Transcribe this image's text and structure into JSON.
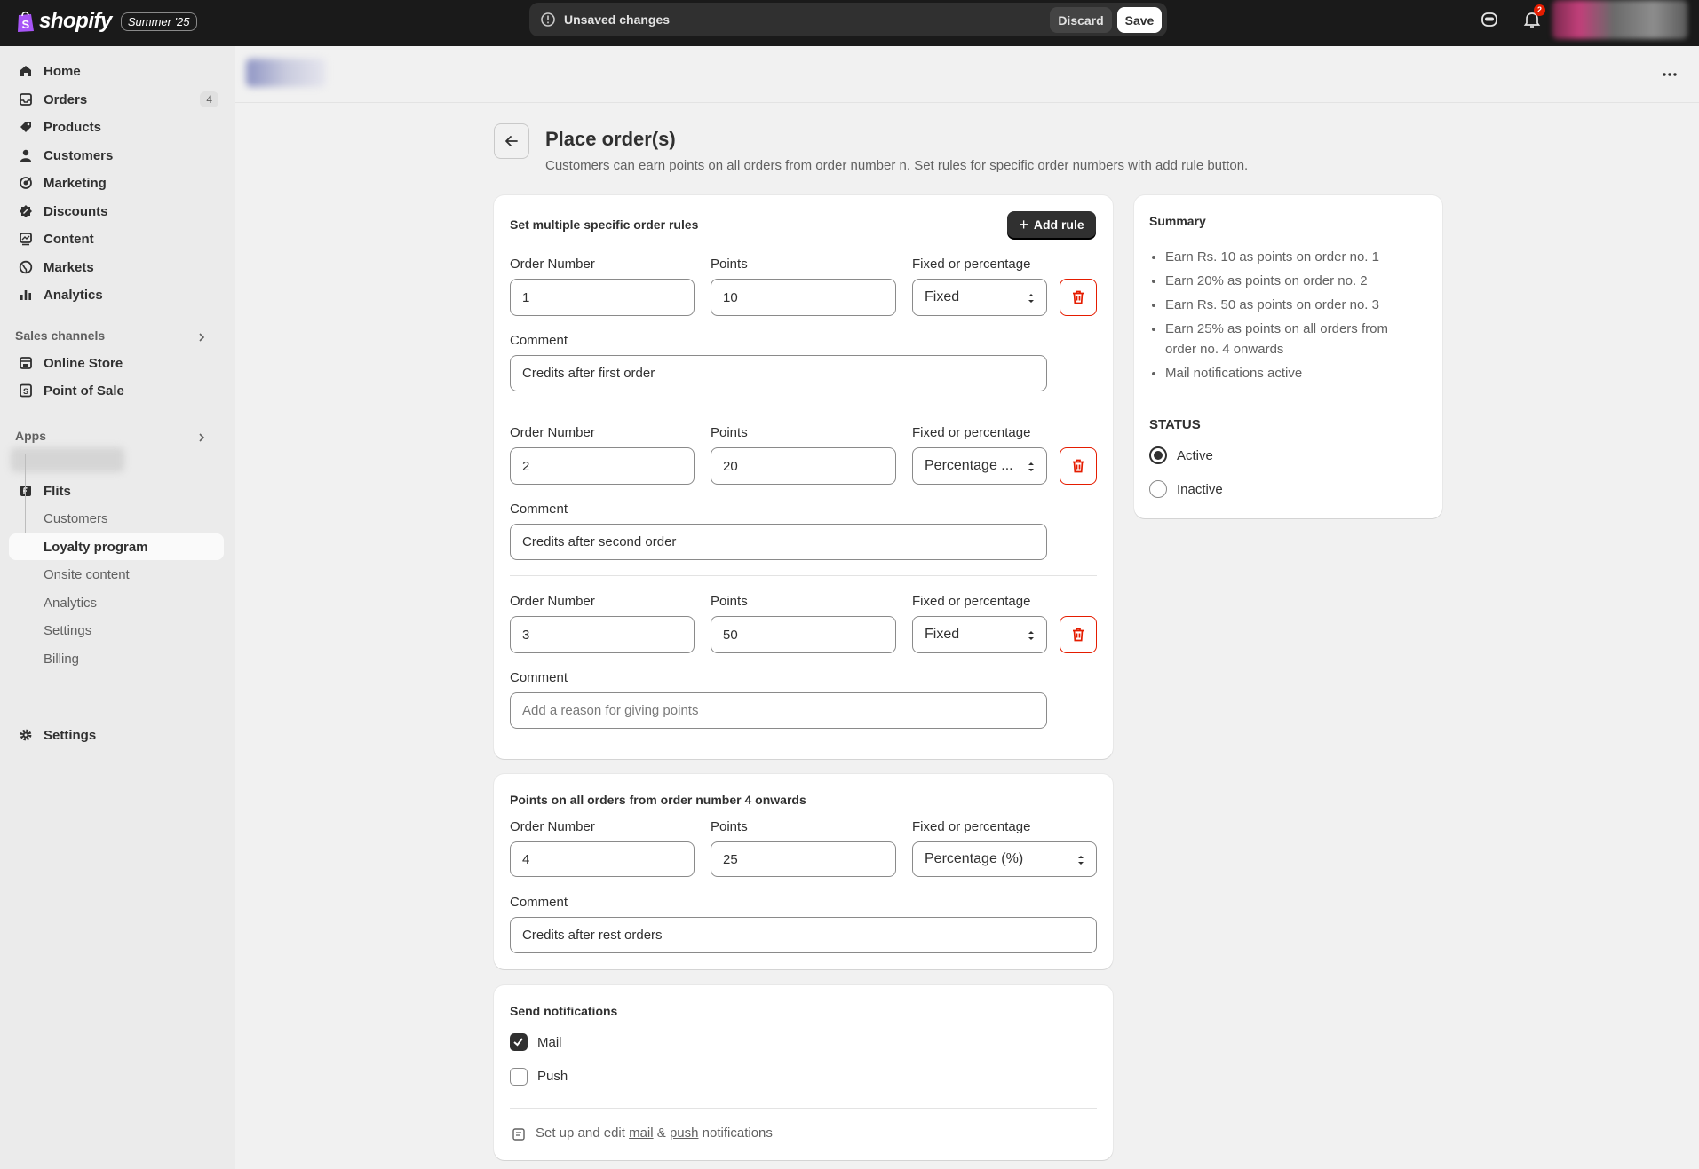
{
  "topbar": {
    "logo_text": "shopify",
    "badge": "Summer '25",
    "unsaved_text": "Unsaved changes",
    "discard_label": "Discard",
    "save_label": "Save",
    "notification_count": "2"
  },
  "sidebar": {
    "items": [
      {
        "label": "Home",
        "icon": "home-icon"
      },
      {
        "label": "Orders",
        "icon": "inbox-icon",
        "count": "4"
      },
      {
        "label": "Products",
        "icon": "tag-icon"
      },
      {
        "label": "Customers",
        "icon": "person-icon"
      },
      {
        "label": "Marketing",
        "icon": "target-icon"
      },
      {
        "label": "Discounts",
        "icon": "discount-icon"
      },
      {
        "label": "Content",
        "icon": "content-icon"
      },
      {
        "label": "Markets",
        "icon": "globe-icon"
      },
      {
        "label": "Analytics",
        "icon": "bar-chart-icon"
      }
    ],
    "sales_channels_title": "Sales channels",
    "channels": [
      {
        "label": "Online Store",
        "icon": "store-icon"
      },
      {
        "label": "Point of Sale",
        "icon": "pos-icon"
      }
    ],
    "apps_title": "Apps",
    "app_name": "Flits",
    "app_sub_items": [
      "Customers",
      "Loyalty program",
      "Onsite content",
      "Analytics",
      "Settings",
      "Billing"
    ],
    "settings_label": "Settings"
  },
  "page": {
    "title": "Place order(s)",
    "subtitle": "Customers can earn points on all orders from order number n. Set rules for specific order numbers with add rule button."
  },
  "rules_card": {
    "title": "Set multiple specific order rules",
    "add_rule_label": "Add rule",
    "order_number_label": "Order Number",
    "points_label": "Points",
    "type_label": "Fixed or percentage",
    "comment_label": "Comment",
    "comment_placeholder": "Add a reason for giving points",
    "rules": [
      {
        "order_number": "1",
        "points": "10",
        "type": "Fixed",
        "comment": "Credits after first order"
      },
      {
        "order_number": "2",
        "points": "20",
        "type": "Percentage ...",
        "comment": "Credits after second order"
      },
      {
        "order_number": "3",
        "points": "50",
        "type": "Fixed",
        "comment": ""
      }
    ]
  },
  "onward_card": {
    "title": "Points on all orders from order number 4 onwards",
    "order_number_label": "Order Number",
    "points_label": "Points",
    "type_label": "Fixed or percentage",
    "comment_label": "Comment",
    "order_number": "4",
    "points": "25",
    "type": "Percentage (%)",
    "comment": "Credits after rest orders"
  },
  "notifications_card": {
    "title": "Send notifications",
    "mail_label": "Mail",
    "mail_checked": true,
    "push_label": "Push",
    "push_checked": false,
    "footer_prefix": "Set up and edit",
    "mail_link": "mail",
    "amp": "&",
    "push_link": "push",
    "footer_suffix": "notifications"
  },
  "summary_card": {
    "title": "Summary",
    "lines": [
      "Earn Rs. 10 as points on order no. 1",
      "Earn 20% as points on order no. 2",
      "Earn Rs. 50 as points on order no. 3",
      "Earn 25% as points on all orders from order no. 4 onwards",
      "Mail notifications active"
    ],
    "status_title": "STATUS",
    "status_options": [
      "Active",
      "Inactive"
    ],
    "status_selected": "Active"
  },
  "colors": {
    "topbar_bg": "#1a1a1a",
    "page_bg": "#f1f1f1",
    "primary_button": "#303030",
    "critical": "#e51c00",
    "logo_green": "#95bf47"
  }
}
